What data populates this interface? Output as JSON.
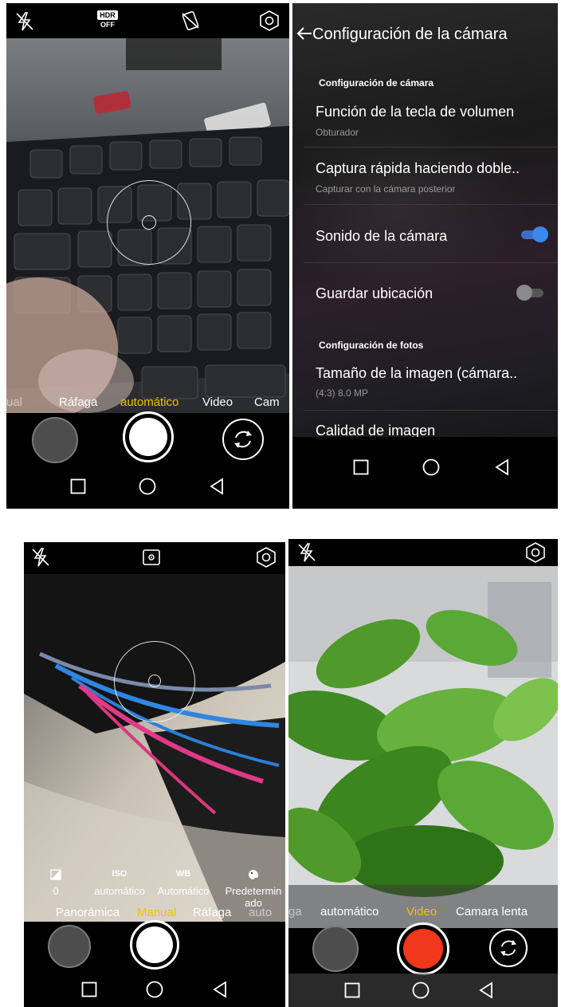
{
  "icons": {
    "flash": "flash-off-icon",
    "hdr": "hdr-off-icon",
    "motion": "no-motion-icon",
    "settings": "settings-hexagon-icon",
    "focus_mode": "focus-mode-icon",
    "switch": "switch-camera-icon",
    "nav": [
      "square-icon",
      "circle-icon",
      "triangle-back-icon"
    ]
  },
  "colors": {
    "active_mode": "#f0c300",
    "toggle_on": "#3d86ea",
    "video_record": "#f2381c"
  },
  "screen1": {
    "hdr_label": "HDR",
    "hdr_state": "OFF",
    "modes": [
      {
        "label": "ual"
      },
      {
        "label": "Ráfaga"
      },
      {
        "label": "automático"
      },
      {
        "label": "Video"
      },
      {
        "label": "Cam"
      }
    ],
    "active_mode": "automático"
  },
  "screen2": {
    "title": "Configuración de la cámara",
    "section_camera": "Configuración de cámara",
    "items": [
      {
        "title": "Función de la tecla de volumen",
        "subtitle": "Obturador"
      },
      {
        "title": "Captura rápida haciendo doble..",
        "subtitle": "Capturar con la cámara posterior"
      },
      {
        "title": "Sonido de la cámara",
        "toggle": true
      },
      {
        "title": "Guardar ubicación",
        "toggle": false
      }
    ],
    "section_photo": "Configuración de fotos",
    "photo_items": [
      {
        "title": "Tamaño de la imagen (cámara..",
        "subtitle": "(4:3) 8.0 MP"
      },
      {
        "title": "Calidad de imagen"
      }
    ]
  },
  "screen3": {
    "params": [
      {
        "icon": "exposure-icon",
        "label": "",
        "value": "0"
      },
      {
        "icon": "iso-icon",
        "label": "ISO",
        "value": "automático"
      },
      {
        "icon": "white-balance-icon",
        "label": "WB",
        "value": "Automático"
      },
      {
        "icon": "palette-icon",
        "label": "",
        "value": "Predetermin\nado"
      }
    ],
    "modes": [
      {
        "label": "Panorámica"
      },
      {
        "label": "Manual"
      },
      {
        "label": "Ráfaga"
      },
      {
        "label": "auto"
      }
    ],
    "active_mode": "Manual"
  },
  "screen4": {
    "modes": [
      {
        "label": "ga"
      },
      {
        "label": "automático"
      },
      {
        "label": "Video"
      },
      {
        "label": "Camara lenta"
      }
    ],
    "active_mode": "Video"
  }
}
